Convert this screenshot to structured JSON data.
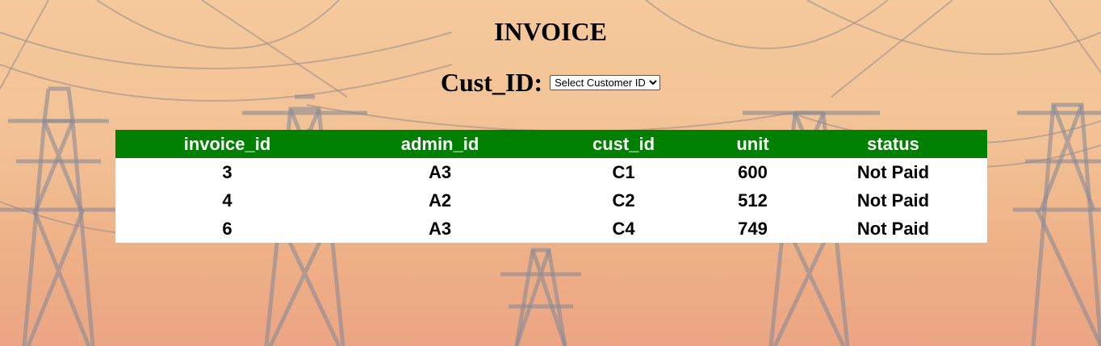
{
  "page": {
    "title": "INVOICE"
  },
  "filter": {
    "label": "Cust_ID:",
    "select_value": "Select Customer ID"
  },
  "table": {
    "headers": [
      "invoice_id",
      "admin_id",
      "cust_id",
      "unit",
      "status"
    ],
    "rows": [
      [
        "3",
        "A3",
        "C1",
        "600",
        "Not Paid"
      ],
      [
        "4",
        "A2",
        "C2",
        "512",
        "Not Paid"
      ],
      [
        "6",
        "A3",
        "C4",
        "749",
        "Not Paid"
      ]
    ]
  },
  "colors": {
    "header_bg": "#008000",
    "header_text": "#ffffff",
    "table_bg": "#ffffff"
  }
}
